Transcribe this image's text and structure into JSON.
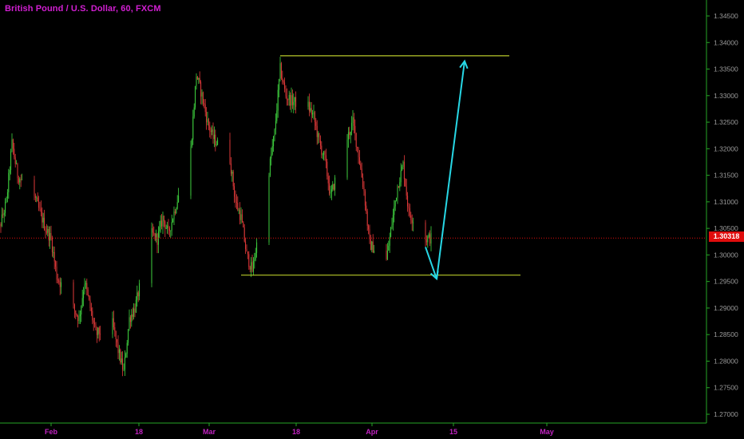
{
  "chart_data": {
    "type": "candlestick",
    "title": "British Pound / U.S. Dollar, 60, FXCM",
    "last_price": "1.30318",
    "ylim": [
      1.2675,
      1.3485
    ],
    "y_ticks": [
      "1.34500",
      "1.34000",
      "1.33500",
      "1.33000",
      "1.32500",
      "1.32000",
      "1.31500",
      "1.31000",
      "1.30500",
      "1.30000",
      "1.29500",
      "1.29000",
      "1.28500",
      "1.28000",
      "1.27500",
      "1.27000"
    ],
    "x_ticks": [
      "Feb",
      "18",
      "Mar",
      "18",
      "Apr",
      "15",
      "May"
    ],
    "price_path_x": [
      "2018-01-22",
      "2018-01-24",
      "2018-01-25",
      "2018-01-26",
      "2018-01-29",
      "2018-01-31",
      "2018-02-01",
      "2018-02-02",
      "2018-02-05",
      "2018-02-06",
      "2018-02-07",
      "2018-02-08",
      "2018-02-09",
      "2018-02-12",
      "2018-02-13",
      "2018-02-14",
      "2018-02-15",
      "2018-02-16",
      "2018-02-19",
      "2018-02-20",
      "2018-02-21",
      "2018-02-22",
      "2018-02-23",
      "2018-02-26",
      "2018-02-27",
      "2018-02-28",
      "2018-03-01",
      "2018-03-02",
      "2018-03-05",
      "2018-03-06",
      "2018-03-07",
      "2018-03-08",
      "2018-03-09",
      "2018-03-12",
      "2018-03-13",
      "2018-03-14",
      "2018-03-15",
      "2018-03-16",
      "2018-03-19",
      "2018-03-20",
      "2018-03-21",
      "2018-03-22",
      "2018-03-23",
      "2018-03-26",
      "2018-03-27",
      "2018-03-28",
      "2018-03-29",
      "2018-03-30",
      "2018-04-02",
      "2018-04-03",
      "2018-04-04",
      "2018-04-05",
      "2018-04-06",
      "2018-04-09",
      "2018-04-10"
    ],
    "price_path_y": [
      1.302,
      1.31,
      1.321,
      1.315,
      1.311,
      1.305,
      1.303,
      1.296,
      1.29,
      1.288,
      1.295,
      1.29,
      1.285,
      1.287,
      1.282,
      1.278,
      1.288,
      1.29,
      1.304,
      1.303,
      1.307,
      1.304,
      1.308,
      1.32,
      1.334,
      1.33,
      1.325,
      1.322,
      1.318,
      1.31,
      1.307,
      1.3,
      1.297,
      1.316,
      1.323,
      1.335,
      1.33,
      1.329,
      1.328,
      1.326,
      1.321,
      1.318,
      1.311,
      1.322,
      1.325,
      1.319,
      1.312,
      1.302,
      1.299,
      1.306,
      1.313,
      1.317,
      1.308,
      1.303,
      1.3032
    ],
    "annotations": {
      "resistance_level": 1.3375,
      "support_level": 1.2962,
      "resistance_line_x": [
        "2018-03-14",
        "2018-04-24"
      ],
      "support_line_x": [
        "2018-03-07",
        "2018-04-26"
      ],
      "arrow_down": {
        "from": [
          "2018-04-09",
          1.3015
        ],
        "to": [
          "2018-04-11",
          1.2955
        ]
      },
      "arrow_up": {
        "from": [
          "2018-04-11",
          1.2955
        ],
        "to": [
          "2018-04-16",
          1.3365
        ]
      }
    },
    "colors": {
      "up": "#3fd23f",
      "down": "#e23a3a",
      "levels": "#b7c82a",
      "arrows": "#27d7e5",
      "last_price": "#e00d0d",
      "axis_text": "#c022c0",
      "grid_axis": "#26a626"
    }
  }
}
